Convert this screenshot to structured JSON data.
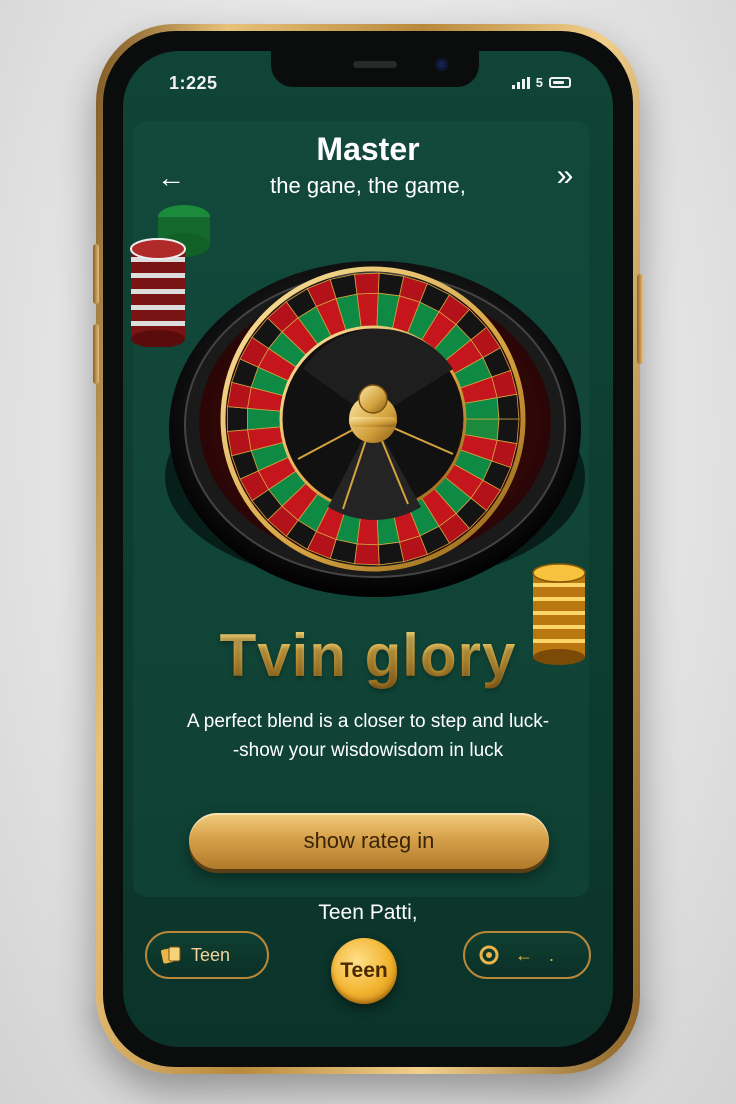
{
  "status_bar": {
    "time": "1:225",
    "carrier": "5"
  },
  "header": {
    "title": "Master",
    "subtitle": "the gane, the game,",
    "back_icon": "arrow-left-icon",
    "forward_icon": "double-chevron-right-icon"
  },
  "hero": {
    "headline": "Tvin glory",
    "description_line1": "A perfect blend is a closer to step  and luck-",
    "description_line2": "-show your wisdowisdom in luck"
  },
  "cta": {
    "label": "show rateg in"
  },
  "footer": {
    "title": "Teen Patti,",
    "left_pill_label": "Teen",
    "left_pill_icon": "cards-icon",
    "center_button_label": "Teen",
    "right_pill_icon": "coin-icon",
    "right_pill_arrow": "←",
    "right_pill_dot": "."
  },
  "colors": {
    "felt": "#0f4436",
    "gold": "#d7a14a",
    "frame_gold": "#e8c27a"
  }
}
